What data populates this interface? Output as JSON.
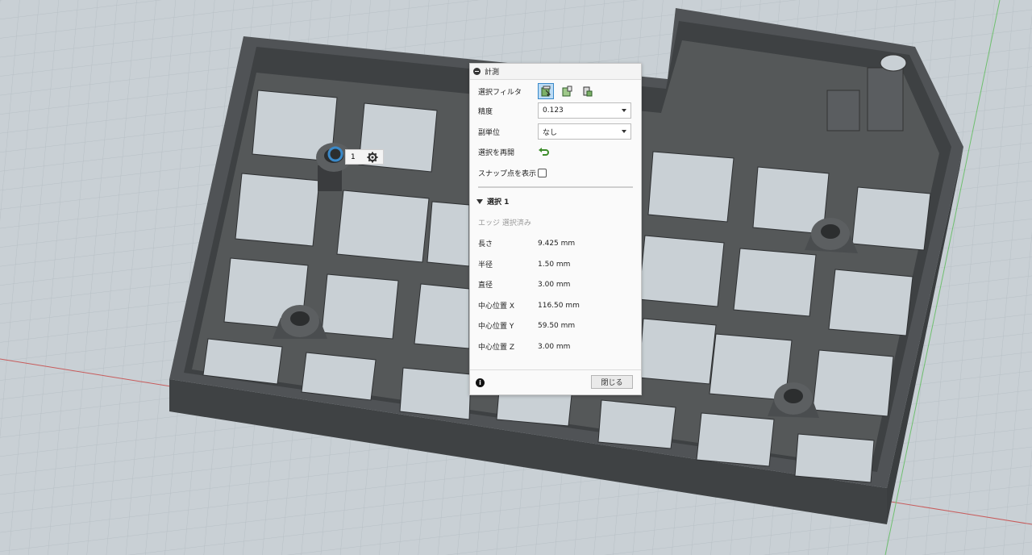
{
  "dialog": {
    "title": "計測",
    "rows": {
      "filter_label": "選択フィルタ",
      "precision_label": "精度",
      "precision_value": "0.123",
      "subunit_label": "副単位",
      "subunit_value": "なし",
      "restart_label": "選択を再開",
      "snap_label": "スナップ点を表示"
    },
    "selection": {
      "header": "選択 1",
      "kind": "エッジ 選択済み",
      "props": [
        {
          "label": "長さ",
          "value": "9.425 mm"
        },
        {
          "label": "半径",
          "value": "1.50 mm"
        },
        {
          "label": "直径",
          "value": "3.00 mm"
        },
        {
          "label": "中心位置 X",
          "value": "116.50 mm"
        },
        {
          "label": "中心位置 Y",
          "value": "59.50 mm"
        },
        {
          "label": "中心位置 Z",
          "value": "3.00 mm"
        }
      ]
    },
    "close_label": "閉じる",
    "info_glyph": "i"
  },
  "viewport": {
    "selection_chip_number": "1",
    "icons": [
      "settings-gear-icon",
      "selection-ring-icon"
    ]
  },
  "colors": {
    "grid_bg": "#c9d0d5",
    "model": "#4a4a4a",
    "accent": "#3a89c9"
  }
}
